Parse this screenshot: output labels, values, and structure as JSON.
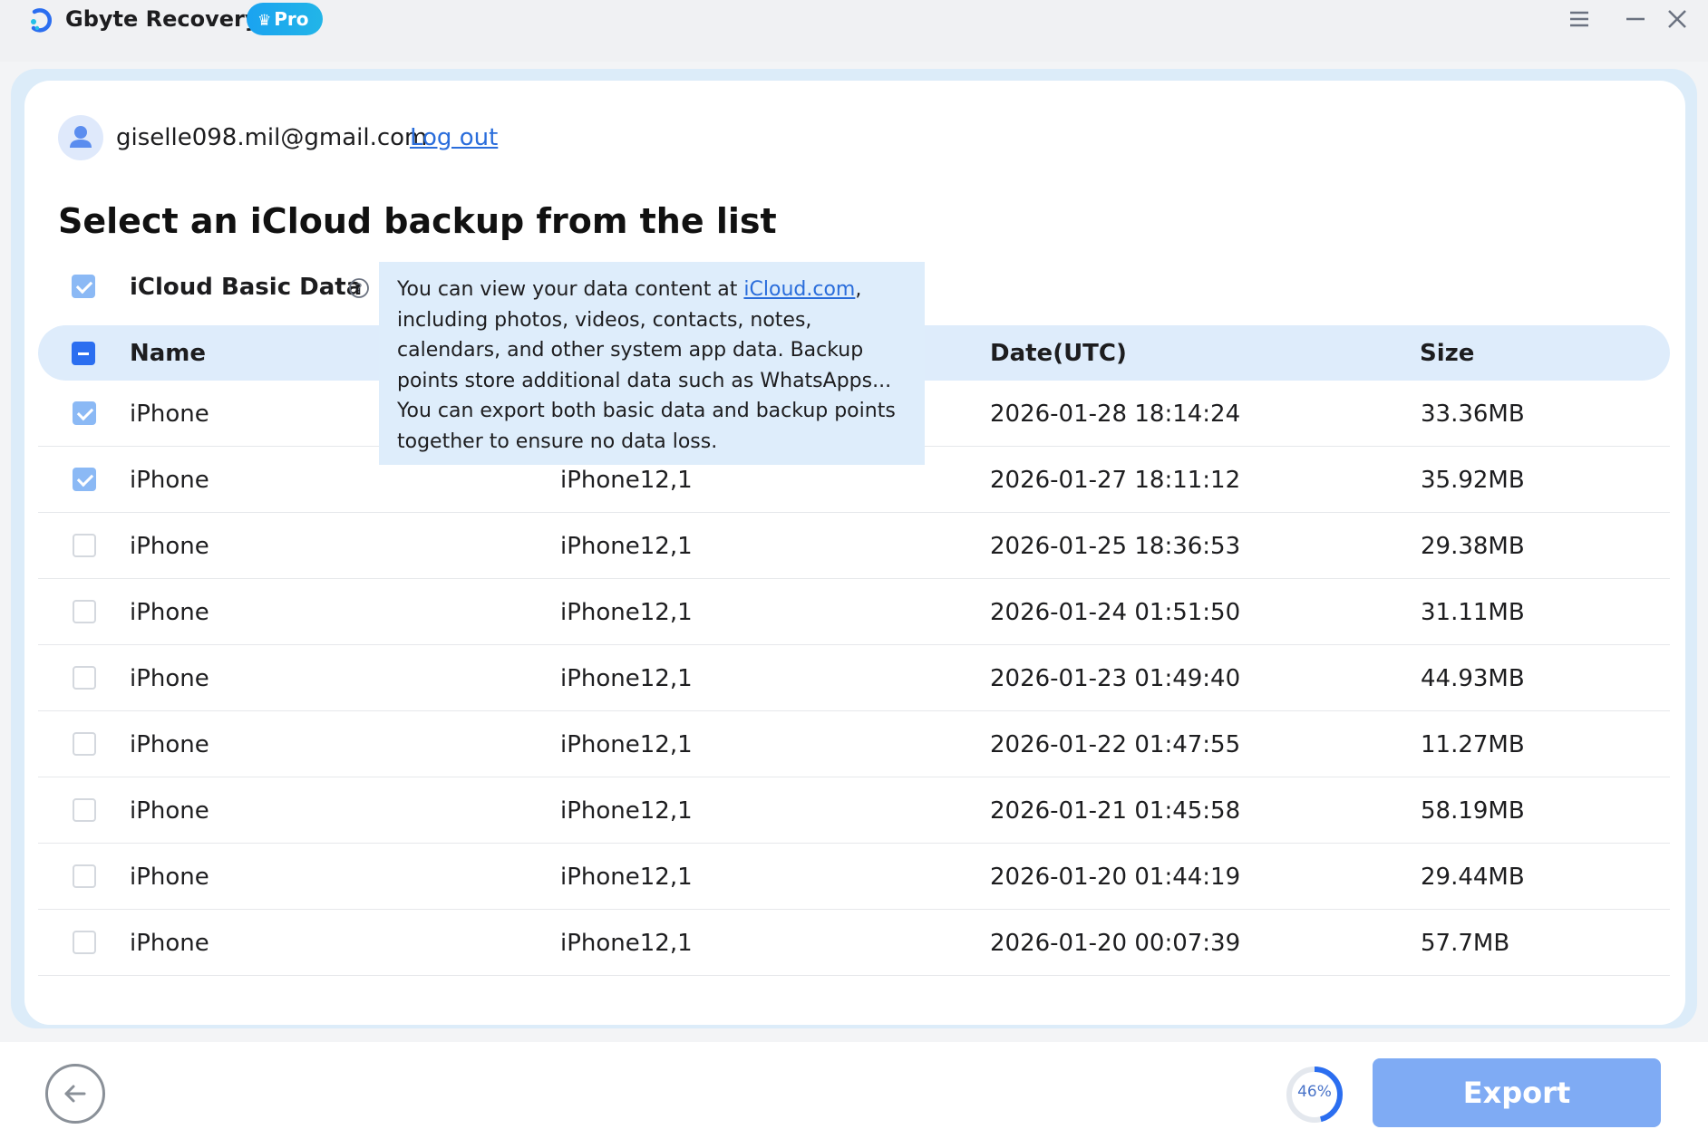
{
  "app": {
    "name": "Gbyte Recovery",
    "badge": "Pro",
    "accent": "#2b6ef0"
  },
  "window_controls": {
    "menu_icon": "hamburger-icon",
    "minimize_icon": "minimize-icon",
    "close_icon": "close-icon"
  },
  "account": {
    "email": "giselle098.mil@gmail.com",
    "logout_label": "Log out"
  },
  "page": {
    "title": "Select an iCloud backup from the list"
  },
  "basic_data": {
    "label": "iCloud Basic Data",
    "checked": true
  },
  "tooltip": {
    "prefix": "You can view your data content at ",
    "link": "iCloud.com",
    "suffix": ", including photos, videos, contacts, notes, calendars, and other system app data. Backup points store additional data such as WhatsApps... You can export both basic data and backup points together to ensure no data loss."
  },
  "table": {
    "headers": {
      "name": "Name",
      "date": "Date(UTC)",
      "size": "Size"
    },
    "rows": [
      {
        "name": "iPhone",
        "model": "",
        "date": "2026-01-28 18:14:24",
        "size": "33.36MB",
        "checked": true
      },
      {
        "name": "iPhone",
        "model": "iPhone12,1",
        "date": "2026-01-27 18:11:12",
        "size": "35.92MB",
        "checked": true
      },
      {
        "name": "iPhone",
        "model": "iPhone12,1",
        "date": "2026-01-25 18:36:53",
        "size": "29.38MB",
        "checked": false
      },
      {
        "name": "iPhone",
        "model": "iPhone12,1",
        "date": "2026-01-24 01:51:50",
        "size": "31.11MB",
        "checked": false
      },
      {
        "name": "iPhone",
        "model": "iPhone12,1",
        "date": "2026-01-23 01:49:40",
        "size": "44.93MB",
        "checked": false
      },
      {
        "name": "iPhone",
        "model": "iPhone12,1",
        "date": "2026-01-22 01:47:55",
        "size": "11.27MB",
        "checked": false
      },
      {
        "name": "iPhone",
        "model": "iPhone12,1",
        "date": "2026-01-21 01:45:58",
        "size": "58.19MB",
        "checked": false
      },
      {
        "name": "iPhone",
        "model": "iPhone12,1",
        "date": "2026-01-20 01:44:19",
        "size": "29.44MB",
        "checked": false
      },
      {
        "name": "iPhone",
        "model": "iPhone12,1",
        "date": "2026-01-20 00:07:39",
        "size": "57.7MB",
        "checked": false
      }
    ]
  },
  "footer": {
    "progress_label": "46%",
    "progress": 0.46,
    "export_label": "Export"
  }
}
